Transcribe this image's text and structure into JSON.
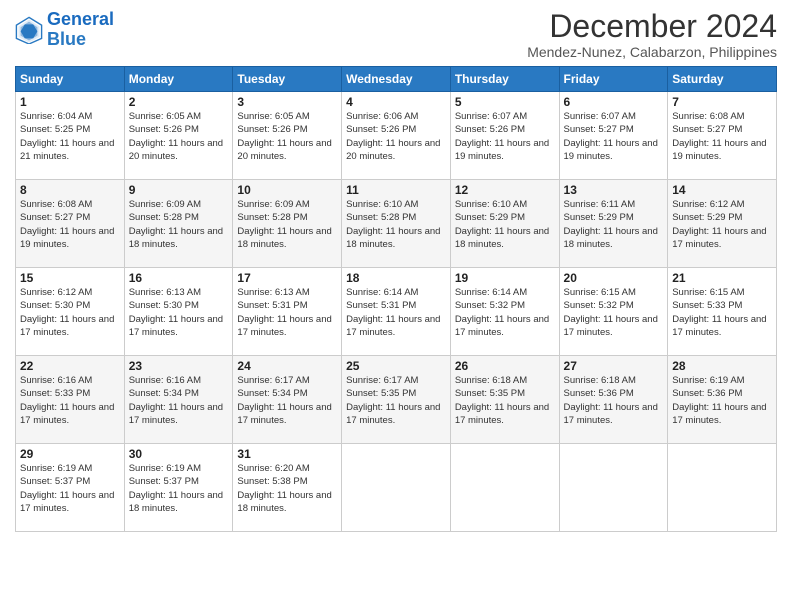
{
  "logo": {
    "line1": "General",
    "line2": "Blue"
  },
  "title": "December 2024",
  "subtitle": "Mendez-Nunez, Calabarzon, Philippines",
  "headers": [
    "Sunday",
    "Monday",
    "Tuesday",
    "Wednesday",
    "Thursday",
    "Friday",
    "Saturday"
  ],
  "weeks": [
    [
      {
        "day": "1",
        "sunrise": "6:04 AM",
        "sunset": "5:25 PM",
        "daylight": "11 hours and 21 minutes."
      },
      {
        "day": "2",
        "sunrise": "6:05 AM",
        "sunset": "5:26 PM",
        "daylight": "11 hours and 20 minutes."
      },
      {
        "day": "3",
        "sunrise": "6:05 AM",
        "sunset": "5:26 PM",
        "daylight": "11 hours and 20 minutes."
      },
      {
        "day": "4",
        "sunrise": "6:06 AM",
        "sunset": "5:26 PM",
        "daylight": "11 hours and 20 minutes."
      },
      {
        "day": "5",
        "sunrise": "6:07 AM",
        "sunset": "5:26 PM",
        "daylight": "11 hours and 19 minutes."
      },
      {
        "day": "6",
        "sunrise": "6:07 AM",
        "sunset": "5:27 PM",
        "daylight": "11 hours and 19 minutes."
      },
      {
        "day": "7",
        "sunrise": "6:08 AM",
        "sunset": "5:27 PM",
        "daylight": "11 hours and 19 minutes."
      }
    ],
    [
      {
        "day": "8",
        "sunrise": "6:08 AM",
        "sunset": "5:27 PM",
        "daylight": "11 hours and 19 minutes."
      },
      {
        "day": "9",
        "sunrise": "6:09 AM",
        "sunset": "5:28 PM",
        "daylight": "11 hours and 18 minutes."
      },
      {
        "day": "10",
        "sunrise": "6:09 AM",
        "sunset": "5:28 PM",
        "daylight": "11 hours and 18 minutes."
      },
      {
        "day": "11",
        "sunrise": "6:10 AM",
        "sunset": "5:28 PM",
        "daylight": "11 hours and 18 minutes."
      },
      {
        "day": "12",
        "sunrise": "6:10 AM",
        "sunset": "5:29 PM",
        "daylight": "11 hours and 18 minutes."
      },
      {
        "day": "13",
        "sunrise": "6:11 AM",
        "sunset": "5:29 PM",
        "daylight": "11 hours and 18 minutes."
      },
      {
        "day": "14",
        "sunrise": "6:12 AM",
        "sunset": "5:29 PM",
        "daylight": "11 hours and 17 minutes."
      }
    ],
    [
      {
        "day": "15",
        "sunrise": "6:12 AM",
        "sunset": "5:30 PM",
        "daylight": "11 hours and 17 minutes."
      },
      {
        "day": "16",
        "sunrise": "6:13 AM",
        "sunset": "5:30 PM",
        "daylight": "11 hours and 17 minutes."
      },
      {
        "day": "17",
        "sunrise": "6:13 AM",
        "sunset": "5:31 PM",
        "daylight": "11 hours and 17 minutes."
      },
      {
        "day": "18",
        "sunrise": "6:14 AM",
        "sunset": "5:31 PM",
        "daylight": "11 hours and 17 minutes."
      },
      {
        "day": "19",
        "sunrise": "6:14 AM",
        "sunset": "5:32 PM",
        "daylight": "11 hours and 17 minutes."
      },
      {
        "day": "20",
        "sunrise": "6:15 AM",
        "sunset": "5:32 PM",
        "daylight": "11 hours and 17 minutes."
      },
      {
        "day": "21",
        "sunrise": "6:15 AM",
        "sunset": "5:33 PM",
        "daylight": "11 hours and 17 minutes."
      }
    ],
    [
      {
        "day": "22",
        "sunrise": "6:16 AM",
        "sunset": "5:33 PM",
        "daylight": "11 hours and 17 minutes."
      },
      {
        "day": "23",
        "sunrise": "6:16 AM",
        "sunset": "5:34 PM",
        "daylight": "11 hours and 17 minutes."
      },
      {
        "day": "24",
        "sunrise": "6:17 AM",
        "sunset": "5:34 PM",
        "daylight": "11 hours and 17 minutes."
      },
      {
        "day": "25",
        "sunrise": "6:17 AM",
        "sunset": "5:35 PM",
        "daylight": "11 hours and 17 minutes."
      },
      {
        "day": "26",
        "sunrise": "6:18 AM",
        "sunset": "5:35 PM",
        "daylight": "11 hours and 17 minutes."
      },
      {
        "day": "27",
        "sunrise": "6:18 AM",
        "sunset": "5:36 PM",
        "daylight": "11 hours and 17 minutes."
      },
      {
        "day": "28",
        "sunrise": "6:19 AM",
        "sunset": "5:36 PM",
        "daylight": "11 hours and 17 minutes."
      }
    ],
    [
      {
        "day": "29",
        "sunrise": "6:19 AM",
        "sunset": "5:37 PM",
        "daylight": "11 hours and 17 minutes."
      },
      {
        "day": "30",
        "sunrise": "6:19 AM",
        "sunset": "5:37 PM",
        "daylight": "11 hours and 18 minutes."
      },
      {
        "day": "31",
        "sunrise": "6:20 AM",
        "sunset": "5:38 PM",
        "daylight": "11 hours and 18 minutes."
      },
      null,
      null,
      null,
      null
    ]
  ]
}
